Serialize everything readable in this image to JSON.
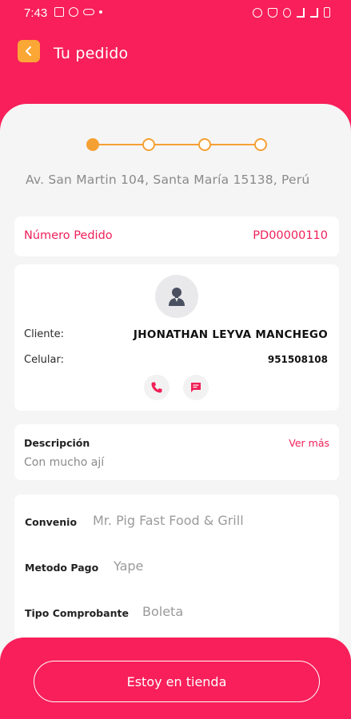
{
  "status": {
    "time": "7:43",
    "left_icons": [
      "image-icon",
      "whatsapp-icon",
      "voicemail-icon",
      "dot-icon"
    ],
    "right_icons": [
      "alarm-icon",
      "mute-icon",
      "location-icon",
      "wifi-icon",
      "signal-icon",
      "battery-icon"
    ]
  },
  "header": {
    "title": "Tu pedido",
    "back_icon": "chevron-left-icon",
    "accent": "#f81f5a",
    "back_color": "#fba736"
  },
  "stepper": {
    "total_steps": 4,
    "current_step": 1,
    "color": "#f5a033"
  },
  "address": "Av. San Martin 104, Santa María 15138, Perú",
  "order": {
    "label": "Número Pedido",
    "value": "PD00000110"
  },
  "client": {
    "avatar_icon": "user-icon",
    "client_label": "Cliente:",
    "client_value": "JHONATHAN LEYVA MANCHEGO",
    "phone_label": "Celular:",
    "phone_value": "951508108",
    "call_icon": "phone-icon",
    "message_icon": "message-icon"
  },
  "description": {
    "label": "Descripción",
    "more": "Ver más",
    "text": "Con mucho ají"
  },
  "info": {
    "convenio_label": "Convenio",
    "convenio_value": "Mr. Pig Fast Food & Grill",
    "pago_label": "Metodo Pago",
    "pago_value": "Yape",
    "comprobante_label": "Tipo Comprobante",
    "comprobante_value": "Boleta"
  },
  "action": {
    "label": "Estoy en tienda"
  }
}
